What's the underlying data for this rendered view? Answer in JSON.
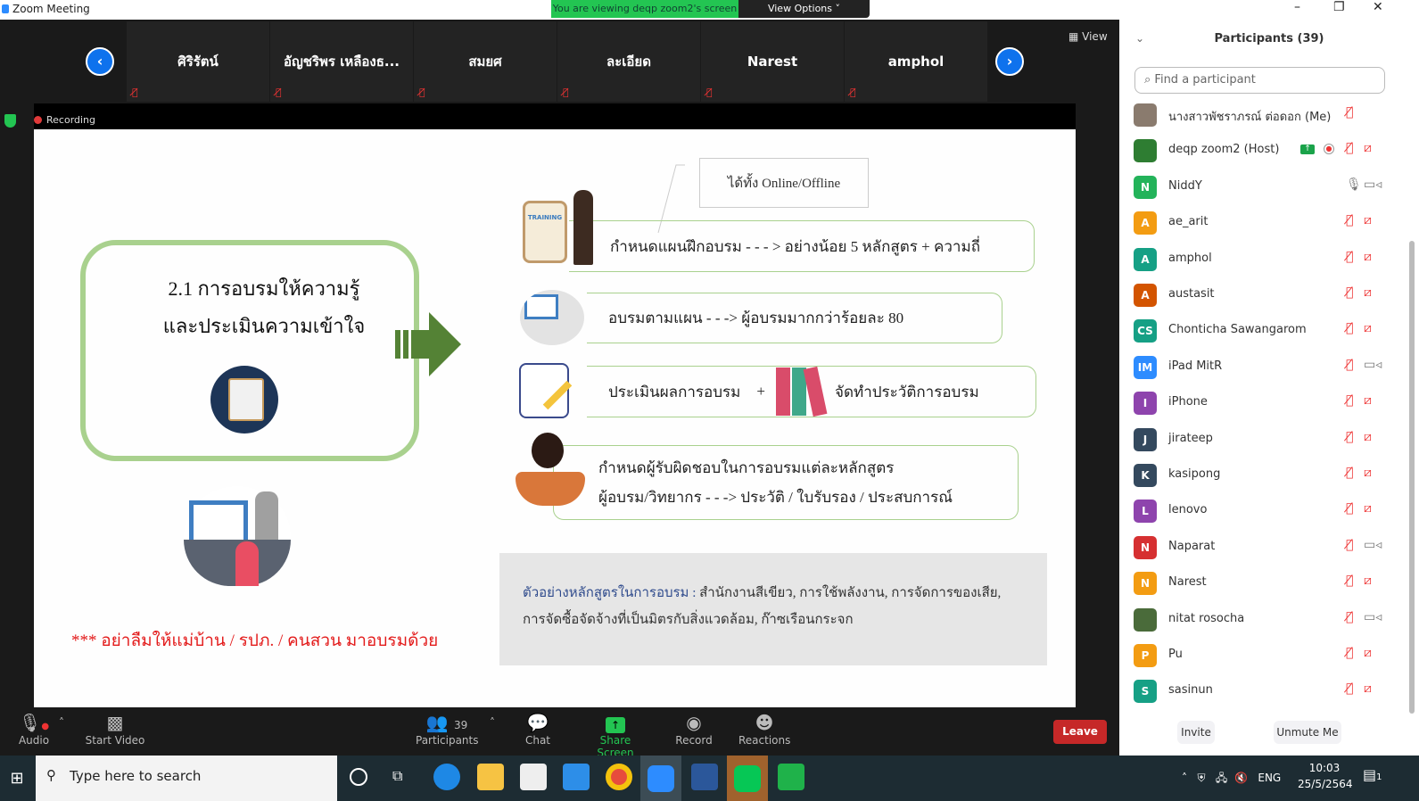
{
  "window": {
    "title": "Zoom Meeting",
    "viewing_banner": "You are viewing deqp zoom2's screen",
    "view_options": "View Options ˅",
    "view_label": "View",
    "recording": "Recording"
  },
  "thumbnails": [
    {
      "name": "ศิริรัตน์"
    },
    {
      "name": "อัญชริพร เหลืองธ..."
    },
    {
      "name": "สมยศ"
    },
    {
      "name": "ละเอียด"
    },
    {
      "name": "Narest"
    },
    {
      "name": "amphol"
    }
  ],
  "slide": {
    "title_line1": "2.1 การอบรมให้ความรู้",
    "title_line2": "และประเมินความเข้าใจ",
    "note": "ได้ทั้ง  Online/Offline",
    "row1": "กำหนดแผนฝึกอบรม - - - >  อย่างน้อย 5 หลักสูตร + ความถี่",
    "row1_icon_label": "TRAINING",
    "row2": "อบรมตามแผน - - ->  ผู้อบรมมากกว่าร้อยละ 80",
    "row3a": "ประเมินผลการอบรม",
    "row3_plus": "+",
    "row3b": "จัดทำประวัติการอบรม",
    "row4_line1": "กำหนดผู้รับผิดชอบในการอบรมแต่ละหลักสูตร",
    "row4_line2": "ผู้อบรม/วิทยากร - - -> ประวัติ / ใบรับรอง / ประสบการณ์",
    "example_label": "ตัวอย่างหลักสูตรในการอบรม :",
    "example_text1": " สำนักงานสีเขียว, การใช้พลังงาน, การจัดการของเสีย,",
    "example_text2": "การจัดซื้อจัดจ้างที่เป็นมิตรกับสิ่งแวดล้อม,  ก๊าซเรือนกระจก",
    "reminder": "*** อย่าลืมให้แม่บ้าน / รปภ. / คนสวน  มาอบรมด้วย"
  },
  "toolbar": {
    "audio": "Audio",
    "start_video": "Start Video",
    "participants": "Participants",
    "participants_count": "39",
    "chat": "Chat",
    "share_screen": "Share Screen",
    "record": "Record",
    "reactions": "Reactions",
    "leave": "Leave"
  },
  "panel": {
    "title": "Participants (39)",
    "search_placeholder": "Find a participant",
    "invite": "Invite",
    "unmute_me": "Unmute Me",
    "participants": [
      {
        "name": "นางสาวพัชราภรณ์ ต่อดอก (Me)",
        "initials": "",
        "color": "#8a7b6e",
        "mic": "muted",
        "video": "none"
      },
      {
        "name": "deqp zoom2 (Host)",
        "initials": "",
        "color": "#2e7d32",
        "mic": "muted",
        "video": "off",
        "sharing": true,
        "recording": true
      },
      {
        "name": "NiddY",
        "initials": "N",
        "color": "#23b35a",
        "mic": "on",
        "video": "on"
      },
      {
        "name": "ae_arit",
        "initials": "A",
        "color": "#f39c12",
        "mic": "muted",
        "video": "off"
      },
      {
        "name": "amphol",
        "initials": "A",
        "color": "#16a085",
        "mic": "muted",
        "video": "off"
      },
      {
        "name": "austasit",
        "initials": "A",
        "color": "#d35400",
        "mic": "muted",
        "video": "off"
      },
      {
        "name": "Chonticha Sawangarom",
        "initials": "CS",
        "color": "#16a085",
        "mic": "muted",
        "video": "off"
      },
      {
        "name": "iPad MitR",
        "initials": "IM",
        "color": "#2d8cff",
        "mic": "muted",
        "video": "on"
      },
      {
        "name": "iPhone",
        "initials": "I",
        "color": "#8e44ad",
        "mic": "muted",
        "video": "off"
      },
      {
        "name": "jirateep",
        "initials": "J",
        "color": "#34495e",
        "mic": "muted",
        "video": "off"
      },
      {
        "name": "kasipong",
        "initials": "K",
        "color": "#34495e",
        "mic": "muted",
        "video": "off"
      },
      {
        "name": "lenovo",
        "initials": "L",
        "color": "#8e44ad",
        "mic": "muted",
        "video": "off"
      },
      {
        "name": "Naparat",
        "initials": "N",
        "color": "#d63031",
        "mic": "muted",
        "video": "on"
      },
      {
        "name": "Narest",
        "initials": "N",
        "color": "#f39c12",
        "mic": "muted",
        "video": "off"
      },
      {
        "name": "nitat rosocha",
        "initials": "",
        "color": "#4a6b3a",
        "mic": "muted",
        "video": "on"
      },
      {
        "name": "Pu",
        "initials": "P",
        "color": "#f39c12",
        "mic": "muted",
        "video": "off"
      },
      {
        "name": "sasinun",
        "initials": "S",
        "color": "#16a085",
        "mic": "muted",
        "video": "off"
      }
    ]
  },
  "taskbar": {
    "search_placeholder": "Type here to search",
    "lang": "ENG",
    "time": "10:03",
    "date": "25/5/2564",
    "notifications": "1"
  }
}
